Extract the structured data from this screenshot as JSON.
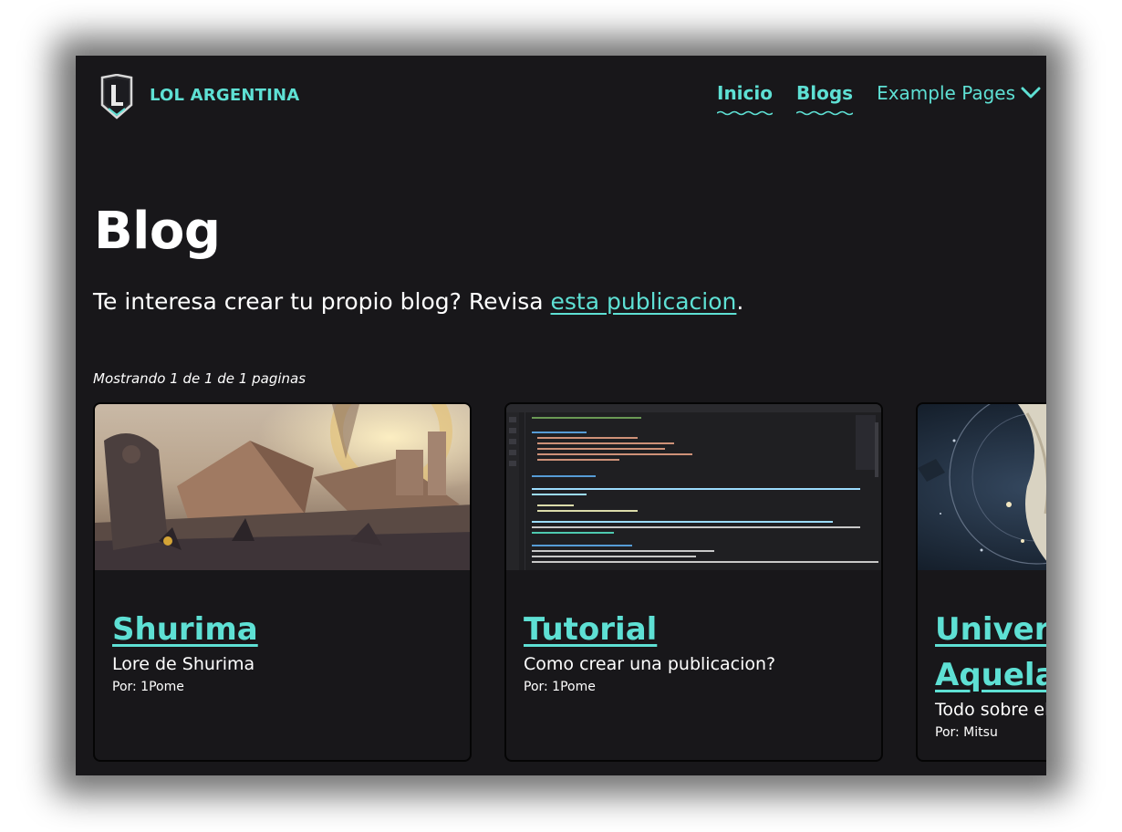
{
  "header": {
    "brand": "LOL ARGENTINA",
    "nav": [
      {
        "label": "Inicio"
      },
      {
        "label": "Blogs"
      },
      {
        "label": "Example Pages"
      }
    ]
  },
  "main": {
    "title": "Blog",
    "lead_prefix": "Te interesa crear tu propio blog? Revisa ",
    "lead_link": "esta publicacion",
    "lead_suffix": ".",
    "pager": "Mostrando 1 de 1 de 1 paginas"
  },
  "cards": [
    {
      "title": "Shurima",
      "description": "Lore de Shurima",
      "author": "Por: 1Pome"
    },
    {
      "title": "Tutorial",
      "description": "Como crear una publicacion?",
      "author": "Por: 1Pome"
    },
    {
      "title_line1": "Univers",
      "title_line2": "Aquelar",
      "description": "Todo sobre el u",
      "author": "Por: Mitsu"
    }
  ],
  "colors": {
    "background": "#18171a",
    "accent": "#5ee0d4",
    "text": "#ffffff"
  },
  "icons": [
    "shield-logo-icon",
    "chevron-down-icon"
  ]
}
